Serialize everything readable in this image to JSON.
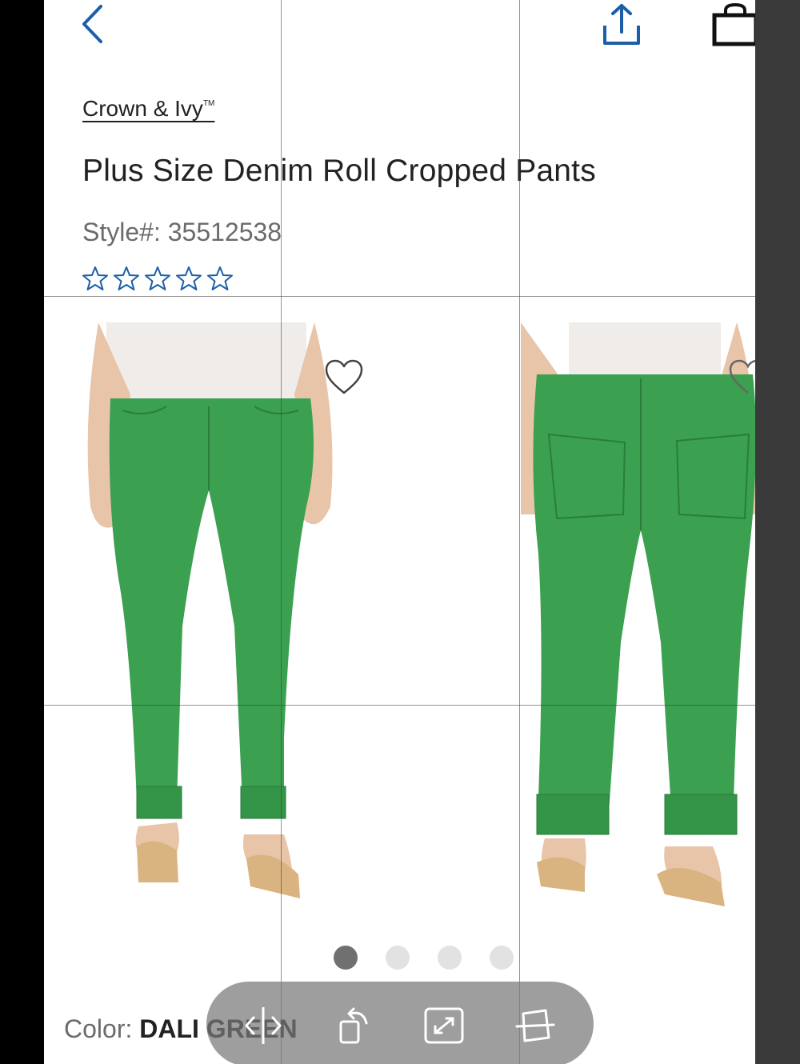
{
  "header": {
    "back_icon": "chevron-left-icon",
    "share_icon": "share-icon",
    "bag_icon": "shopping-bag-icon"
  },
  "product": {
    "brand": "Crown & Ivy",
    "brand_mark": "TM",
    "title": "Plus Size Denim Roll Cropped Pants",
    "style_label": "Style#: 35512538",
    "rating": 0,
    "rating_max": 5,
    "color_label": "Color:",
    "color_value": "DALI GREEN"
  },
  "gallery": {
    "images": [
      "front-view",
      "back-view"
    ],
    "image_count": 4,
    "active_index": 0,
    "favorite_icon": "heart-outline-icon"
  },
  "colors": {
    "accent": "#1a5fa8",
    "pants_green": "#3ba050",
    "text_dark": "#222222",
    "text_gray": "#6b6b6b",
    "dot_active": "#707070",
    "dot_inactive": "#e2e2e2"
  },
  "toolbar": {
    "items": [
      "split-icon",
      "rotate-icon",
      "fullscreen-icon",
      "crop-icon"
    ]
  }
}
